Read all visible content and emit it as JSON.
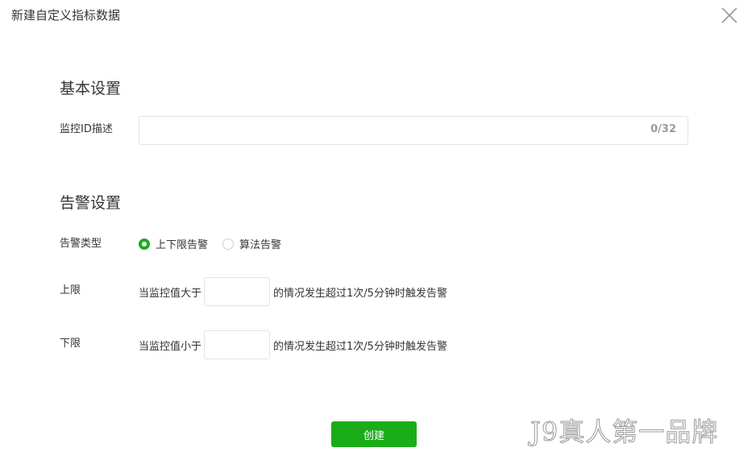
{
  "dialog": {
    "title": "新建自定义指标数据",
    "close_icon": "close-icon"
  },
  "basic": {
    "section_title": "基本设置",
    "id_label": "监控ID描述",
    "id_value": "",
    "id_counter": "0/32"
  },
  "alarm": {
    "section_title": "告警设置",
    "type_label": "告警类型",
    "type_options": [
      {
        "label": "上下限告警",
        "checked": true
      },
      {
        "label": "算法告警",
        "checked": false
      }
    ],
    "upper": {
      "label": "上限",
      "prefix": "当监控值大于",
      "value": "",
      "suffix": "的情况发生超过1次/5分钟时触发告警"
    },
    "lower": {
      "label": "下限",
      "prefix": "当监控值小于",
      "value": "",
      "suffix": "的情况发生超过1次/5分钟时触发告警"
    }
  },
  "footer": {
    "create_label": "创建"
  },
  "watermark": "J9真人第一品牌",
  "colors": {
    "accent": "#1aad19",
    "border": "#e2e2e2",
    "text": "#353535",
    "muted": "#9a9a9a"
  }
}
